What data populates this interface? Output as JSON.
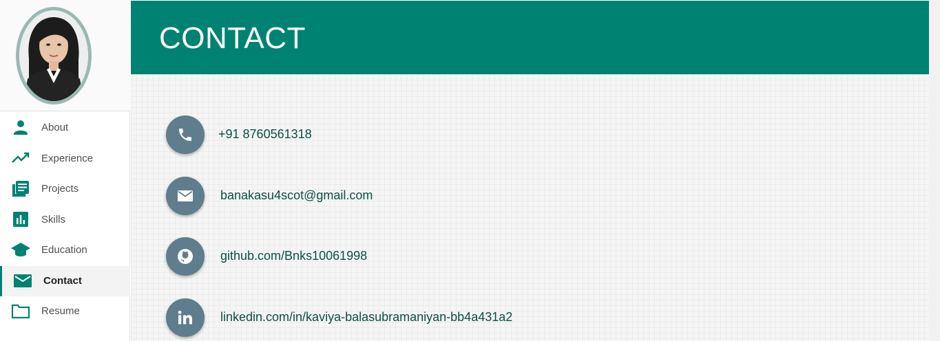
{
  "header": {
    "title": "CONTACT"
  },
  "sidebar": {
    "items": [
      {
        "label": "About",
        "icon": "person-icon"
      },
      {
        "label": "Experience",
        "icon": "trending-up-icon"
      },
      {
        "label": "Projects",
        "icon": "article-stack-icon"
      },
      {
        "label": "Skills",
        "icon": "bar-chart-icon"
      },
      {
        "label": "Education",
        "icon": "graduation-cap-icon"
      },
      {
        "label": "Contact",
        "icon": "mail-icon",
        "active": true
      },
      {
        "label": "Resume",
        "icon": "folder-icon"
      }
    ]
  },
  "contacts": [
    {
      "type": "phone",
      "text": "+91 8760561318",
      "icon": "phone-icon"
    },
    {
      "type": "email",
      "text": "banakasu4scot@gmail.com",
      "icon": "envelope-icon"
    },
    {
      "type": "github",
      "text": "github.com/Bnks10061998",
      "icon": "github-icon"
    },
    {
      "type": "linkedin",
      "text": "linkedin.com/in/kaviya-balasubramaniyan-bb4a431a2",
      "icon": "linkedin-icon"
    }
  ],
  "colors": {
    "accent": "#008272",
    "icon_circle": "#5f7d8c",
    "contact_text": "#0b4f45",
    "avatar_ring": "#9bb9b4"
  }
}
